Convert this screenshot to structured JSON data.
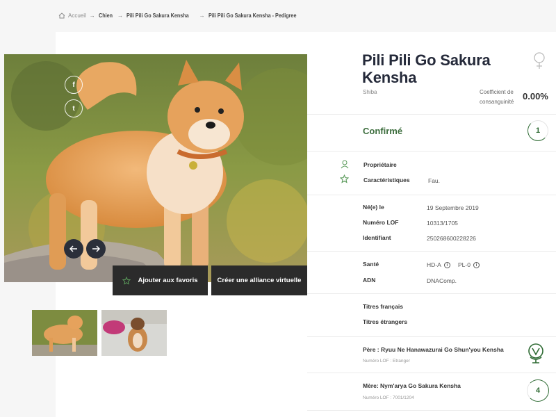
{
  "breadcrumb": {
    "home": "Accueil",
    "items": [
      "Chien",
      "Pili Pili Go Sakura Kensha",
      "Pili Pili Go Sakura Kensha - Pedigree"
    ]
  },
  "dog": {
    "name": "Pili Pili Go Sakura Kensha",
    "breed": "Shiba",
    "gender_icon": "female-icon",
    "coefficient_label": "Coefficient de consanguinité",
    "coefficient_value": "0.00%"
  },
  "status": {
    "label": "Confirmé",
    "count": "1"
  },
  "sections": {
    "owner": "Propriétaire",
    "characteristics": "Caractéristiques",
    "characteristics_value": "Fau."
  },
  "details": [
    {
      "label": "Né(e) le",
      "value": "19 Septembre 2019"
    },
    {
      "label": "Numéro LOF",
      "value": "10313/1705"
    },
    {
      "label": "Identifiant",
      "value": "250268600228226"
    }
  ],
  "health": {
    "label": "Santé",
    "tests": [
      "HD-A",
      "PL-0"
    ],
    "dna_label": "ADN",
    "dna_value": "DNAComp."
  },
  "titles": {
    "french": "Titres français",
    "foreign": "Titres étrangers"
  },
  "father": {
    "label": "Père : Ryuu Ne Hanawazurai Go Shun'you Kensha",
    "sub": "Numéro LOF : Etranger"
  },
  "mother": {
    "label": "Mère: Nym'arya Go Sakura Kensha",
    "sub": "Numéro LOF : 7001/1204",
    "count": "4"
  },
  "actions": {
    "favorites": "Ajouter aux favoris",
    "alliance": "Créer une alliance virtuelle"
  },
  "social": {
    "facebook": "f",
    "twitter": "t"
  },
  "colors": {
    "accent": "#3d6e3e",
    "dark": "#2b2b2b",
    "title": "#252a3a"
  }
}
